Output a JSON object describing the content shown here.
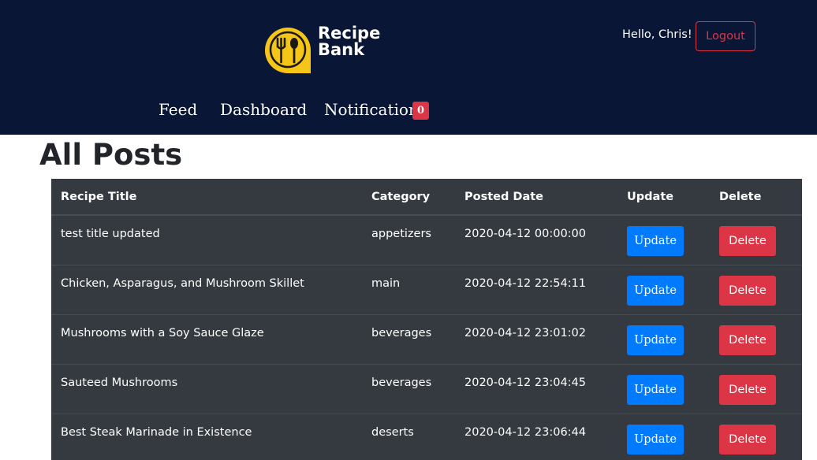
{
  "header": {
    "logo_line1": "Recipe",
    "logo_line2": "Bank",
    "greeting": "Hello, Chris!",
    "logout_label": "Logout",
    "nav": [
      {
        "label": "Feed"
      },
      {
        "label": "Dashboard"
      },
      {
        "label": "Notification"
      }
    ],
    "notification_count": "0"
  },
  "main": {
    "title": "All Posts",
    "columns": [
      "Recipe Title",
      "Category",
      "Posted Date",
      "Update",
      "Delete"
    ],
    "update_label": "Update",
    "delete_label": "Delete",
    "rows": [
      {
        "title": "test title updated",
        "category": "appetizers",
        "date": "2020-04-12 00:00:00"
      },
      {
        "title": "Chicken, Asparagus, and Mushroom Skillet",
        "category": "main",
        "date": "2020-04-12 22:54:11"
      },
      {
        "title": "Mushrooms with a Soy Sauce Glaze",
        "category": "beverages",
        "date": "2020-04-12 23:01:02"
      },
      {
        "title": "Sauteed Mushrooms",
        "category": "beverages",
        "date": "2020-04-12 23:04:45"
      },
      {
        "title": "Best Steak Marinade in Existence",
        "category": "deserts",
        "date": "2020-04-12 23:06:44"
      }
    ]
  },
  "colors": {
    "header_bg": "#0a1636",
    "table_bg": "#343a40",
    "primary": "#007bff",
    "danger": "#dc3545",
    "logo_yellow": "#f5c518"
  },
  "icons": {
    "logo": "fork-spoon-icon"
  }
}
